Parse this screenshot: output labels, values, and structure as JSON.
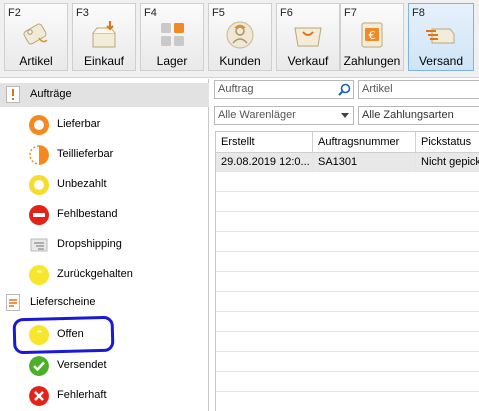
{
  "toolbar": {
    "buttons": [
      {
        "key": "F2",
        "label": "Artikel",
        "icon": "tag-icon"
      },
      {
        "key": "F3",
        "label": "Einkauf",
        "icon": "inbox-download-icon"
      },
      {
        "key": "F4",
        "label": "Lager",
        "icon": "warehouse-grid-icon"
      },
      {
        "key": "F5",
        "label": "Kunden",
        "icon": "customer-icon"
      },
      {
        "key": "F6",
        "label": "Verkauf",
        "icon": "sales-basket-icon"
      },
      {
        "key": "F7",
        "label": "Zahlungen",
        "icon": "euro-payment-icon"
      },
      {
        "key": "F8",
        "label": "Versand",
        "icon": "shipping-truck-icon",
        "active": true
      }
    ]
  },
  "sidebar": {
    "groups": [
      {
        "label": "Aufträge",
        "icon": "order-exclamation-icon"
      },
      {
        "label": "Lieferscheine",
        "icon": "delivery-note-icon"
      }
    ],
    "auftraege_items": [
      {
        "label": "Lieferbar",
        "icon": "orange-ring-icon",
        "color": "#f5891f"
      },
      {
        "label": "Teillieferbar",
        "icon": "half-circle-icon",
        "color": "#f5891f"
      },
      {
        "label": "Unbezahlt",
        "icon": "yellow-ring-icon",
        "color": "#f7dc2b"
      },
      {
        "label": "Fehlbestand",
        "icon": "red-minus-icon",
        "color": "#e2231a"
      },
      {
        "label": "Dropshipping",
        "icon": "dropshipping-icon",
        "color": "#b9b9b9"
      },
      {
        "label": "Zurückgehalten",
        "icon": "yellow-ellipsis-icon",
        "color": "#f7e62b"
      }
    ],
    "lieferscheine_items": [
      {
        "label": "Offen",
        "icon": "yellow-ellipsis-icon",
        "color": "#f7e62b"
      },
      {
        "label": "Versendet",
        "icon": "green-check-icon",
        "color": "#4caf2a"
      },
      {
        "label": "Fehlerhaft",
        "icon": "red-x-icon",
        "color": "#e2231a"
      }
    ]
  },
  "filters": {
    "auftrag_placeholder": "Auftrag",
    "artikel_placeholder": "Artikel",
    "warehouse_select": "Alle Warenläger",
    "payment_select": "Alle Zahlungsarten"
  },
  "grid": {
    "columns": [
      "Erstellt",
      "Auftragsnummer",
      "Pickstatus"
    ],
    "rows": [
      [
        "29.08.2019 12:0...",
        "SA1301",
        "Nicht gepickt"
      ]
    ]
  }
}
